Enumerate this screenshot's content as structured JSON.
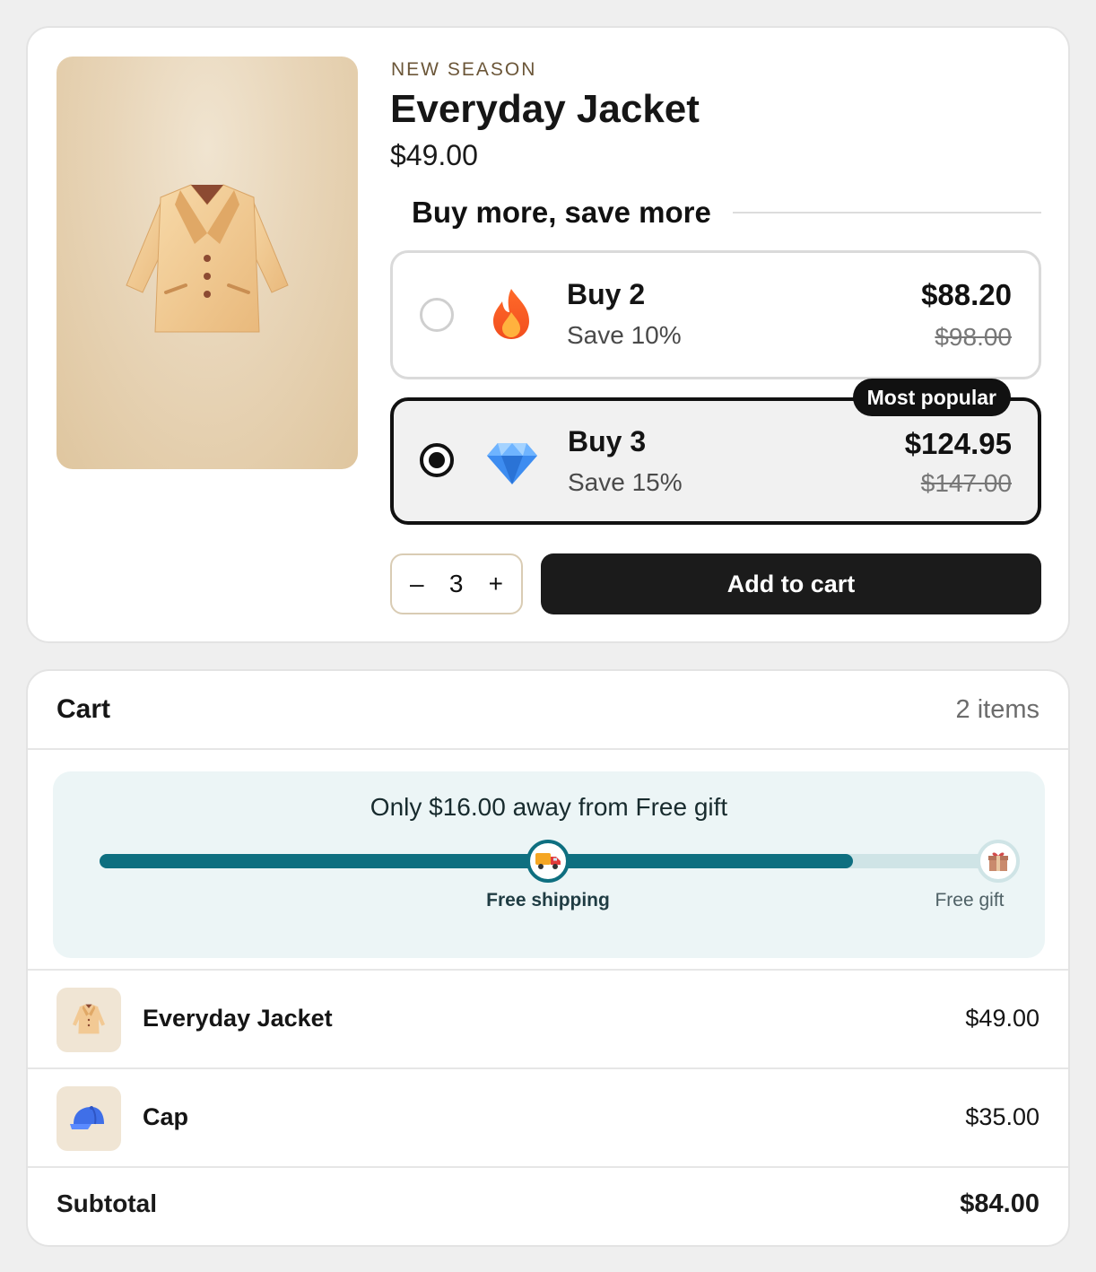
{
  "product": {
    "eyebrow": "NEW SEASON",
    "title": "Everyday Jacket",
    "price": "$49.00",
    "image_icon": "jacket-icon"
  },
  "bundle": {
    "heading": "Buy more, save more",
    "offers": [
      {
        "label": "Buy 2",
        "save": "Save 10%",
        "price": "$88.20",
        "old_price": "$98.00",
        "icon": "fire-icon",
        "selected": false
      },
      {
        "label": "Buy 3",
        "save": "Save 15%",
        "price": "$124.95",
        "old_price": "$147.00",
        "icon": "gem-icon",
        "selected": true,
        "badge": "Most popular"
      }
    ]
  },
  "quantity": {
    "minus": "–",
    "value": "3",
    "plus": "+"
  },
  "add_to_cart_label": "Add to cart",
  "cart": {
    "title": "Cart",
    "count": "2 items",
    "progress": {
      "message": "Only $16.00 away from Free gift",
      "fill_fraction": 0.82,
      "milestones": [
        {
          "label": "Free shipping",
          "icon": "truck-icon",
          "reached": true
        },
        {
          "label": "Free gift",
          "icon": "gift-icon",
          "reached": false
        }
      ]
    },
    "items": [
      {
        "name": "Everyday Jacket",
        "price": "$49.00",
        "icon": "jacket-icon"
      },
      {
        "name": "Cap",
        "price": "$35.00",
        "icon": "cap-icon"
      }
    ],
    "subtotal_label": "Subtotal",
    "subtotal_value": "$84.00"
  },
  "colors": {
    "accent": "#0e6f80",
    "track": "#cfe4e6",
    "button": "#1b1b1b",
    "panel": "#ecf5f6"
  }
}
